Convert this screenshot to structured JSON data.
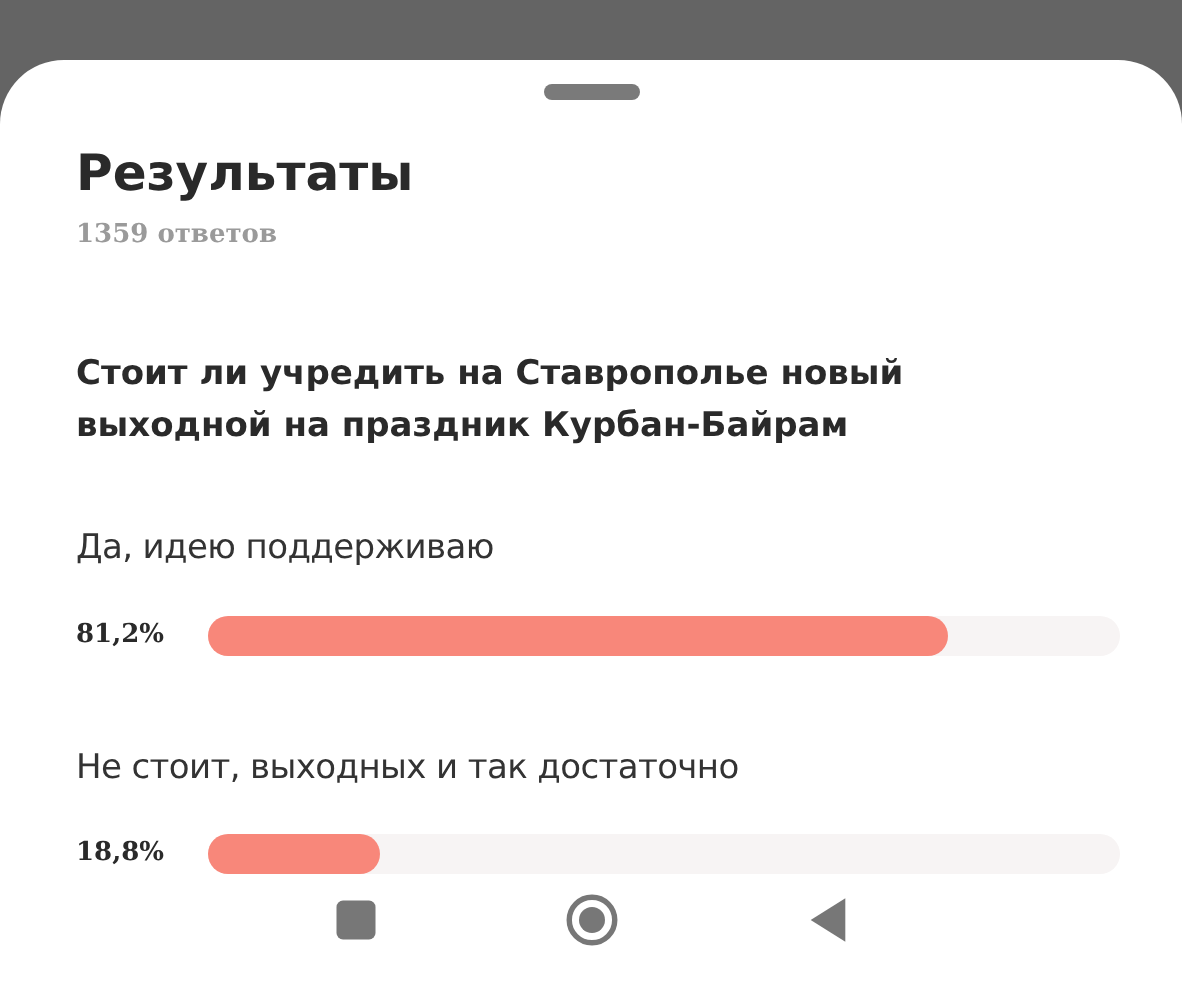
{
  "sheet": {
    "title": "Результаты",
    "responses": "1359 ответов"
  },
  "poll": {
    "question": "Стоит ли учредить на Ставрополье новый выходной на праздник Курбан-Байрам",
    "options": [
      {
        "label": "Да, идею поддерживаю",
        "percent": "81,2%",
        "level": 0.812
      },
      {
        "label": "Не стоит, выходных и так достаточно",
        "percent": "18,8%",
        "level": 0.188
      }
    ]
  },
  "nav_bar": [
    {
      "kind": "recents"
    },
    {
      "kind": "home"
    },
    {
      "kind": "back"
    }
  ]
}
